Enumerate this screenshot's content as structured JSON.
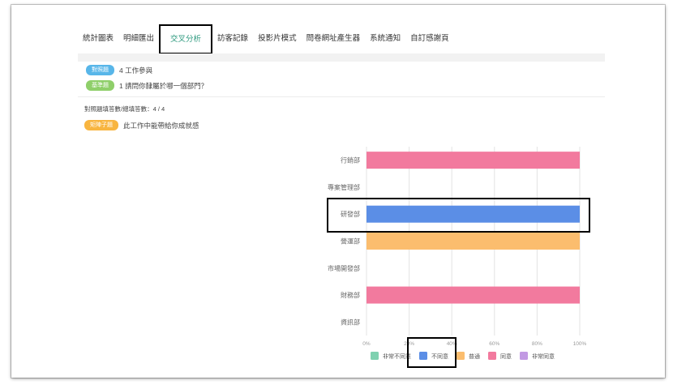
{
  "tabs": [
    {
      "label": "統計圖表",
      "active": false
    },
    {
      "label": "明細匯出",
      "active": false
    },
    {
      "label": "交叉分析",
      "active": true
    },
    {
      "label": "訪客記錄",
      "active": false
    },
    {
      "label": "投影片模式",
      "active": false
    },
    {
      "label": "問卷網址產生器",
      "active": false
    },
    {
      "label": "系統通知",
      "active": false
    },
    {
      "label": "自訂感謝頁",
      "active": false
    }
  ],
  "compare_question": {
    "badge": "對照題",
    "text": "4 工作參與"
  },
  "base_question": {
    "badge": "基準題",
    "text": "1 請問你隸屬於哪一個部門？"
  },
  "response_count": "對照題填答數/總填答數：4 / 4",
  "sub_question": {
    "badge": "矩陣子題",
    "text": "此工作中能帶給你成就感"
  },
  "colors": {
    "strongly_disagree": "#7fd1b0",
    "disagree": "#5b8ee6",
    "neutral": "#fbbd6e",
    "agree": "#f27a9e",
    "strongly_agree": "#c29ae3"
  },
  "chart_data": {
    "type": "bar",
    "orientation": "horizontal",
    "stacked": true,
    "categories": [
      "行銷部",
      "專案管理部",
      "研發部",
      "營運部",
      "市場開發部",
      "財務部",
      "資訊部"
    ],
    "series": [
      {
        "name": "非常不同意",
        "color": "#7fd1b0",
        "values": [
          0,
          0,
          0,
          0,
          0,
          0,
          0
        ]
      },
      {
        "name": "不同意",
        "color": "#5b8ee6",
        "values": [
          0,
          0,
          100,
          0,
          0,
          0,
          0
        ]
      },
      {
        "name": "普通",
        "color": "#fbbd6e",
        "values": [
          0,
          0,
          0,
          100,
          0,
          0,
          0
        ]
      },
      {
        "name": "同意",
        "color": "#f27a9e",
        "values": [
          100,
          0,
          0,
          0,
          0,
          100,
          0
        ]
      },
      {
        "name": "非常同意",
        "color": "#c29ae3",
        "values": [
          0,
          0,
          0,
          0,
          0,
          0,
          0
        ]
      }
    ],
    "x_ticks": [
      "0%",
      "20%",
      "40%",
      "60%",
      "80%",
      "100%"
    ],
    "xlim": [
      0,
      100
    ],
    "grid": true,
    "legend": "bottom"
  }
}
